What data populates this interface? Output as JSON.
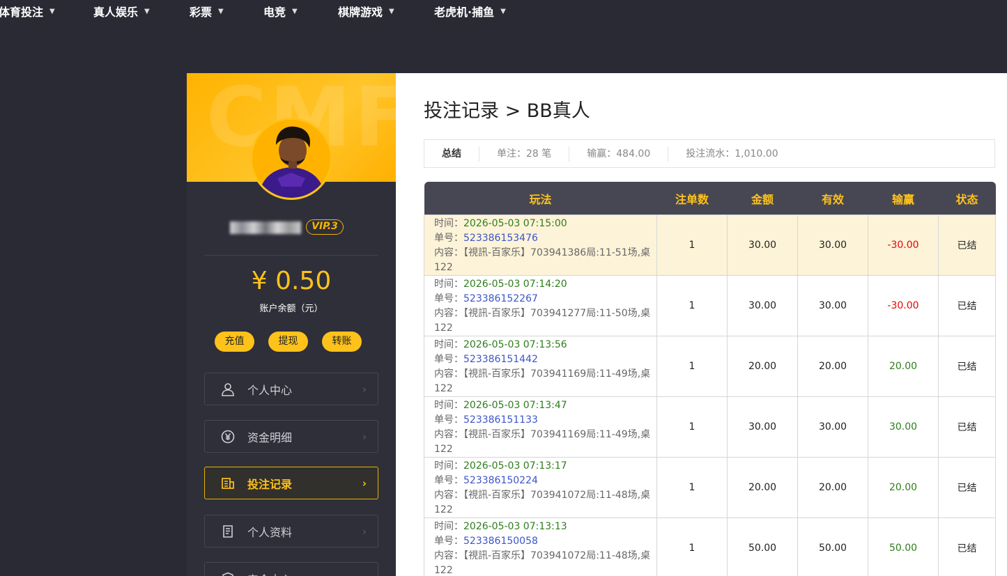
{
  "nav": [
    {
      "label": "体育投注"
    },
    {
      "label": "真人娱乐"
    },
    {
      "label": "彩票"
    },
    {
      "label": "电竞"
    },
    {
      "label": "棋牌游戏"
    },
    {
      "label": "老虎机·捕鱼"
    }
  ],
  "profile": {
    "vip": "VIP.3",
    "balance": "¥ 0.50",
    "balance_label": "账户余额（元）",
    "buttons": [
      "充值",
      "提现",
      "转账"
    ]
  },
  "menu": [
    {
      "label": "个人中心",
      "icon": "user-icon"
    },
    {
      "label": "资金明细",
      "icon": "yuan-cycle-icon"
    },
    {
      "label": "投注记录",
      "icon": "bet-record-icon",
      "active": true
    },
    {
      "label": "个人资料",
      "icon": "profile-doc-icon"
    },
    {
      "label": "安全中心",
      "icon": "shield-icon"
    }
  ],
  "page": {
    "title": "投注记录 > BB真人"
  },
  "summary": {
    "label": "总结",
    "count": "单注：28 笔",
    "profit": "输赢：484.00",
    "turnover": "投注流水：1,010.00"
  },
  "table": {
    "headers": [
      "玩法",
      "注单数",
      "金额",
      "有效",
      "输赢",
      "状态"
    ],
    "labels": {
      "time": "时间：",
      "order": "单号：",
      "content": "内容："
    },
    "rows": [
      {
        "time": "2026-05-03 07:15:00",
        "order": "523386153476",
        "content": "【視訊-百家乐】703941386局:11-51场,桌122",
        "count": "1",
        "amount": "30.00",
        "valid": "30.00",
        "win": "-30.00",
        "status": "已结"
      },
      {
        "time": "2026-05-03 07:14:20",
        "order": "523386152267",
        "content": "【視訊-百家乐】703941277局:11-50场,桌122",
        "count": "1",
        "amount": "30.00",
        "valid": "30.00",
        "win": "-30.00",
        "status": "已结"
      },
      {
        "time": "2026-05-03 07:13:56",
        "order": "523386151442",
        "content": "【視訊-百家乐】703941169局:11-49场,桌122",
        "count": "1",
        "amount": "20.00",
        "valid": "20.00",
        "win": "20.00",
        "status": "已结"
      },
      {
        "time": "2026-05-03 07:13:47",
        "order": "523386151133",
        "content": "【視訊-百家乐】703941169局:11-49场,桌122",
        "count": "1",
        "amount": "30.00",
        "valid": "30.00",
        "win": "30.00",
        "status": "已结"
      },
      {
        "time": "2026-05-03 07:13:17",
        "order": "523386150224",
        "content": "【視訊-百家乐】703941072局:11-48场,桌122",
        "count": "1",
        "amount": "20.00",
        "valid": "20.00",
        "win": "20.00",
        "status": "已结"
      },
      {
        "time": "2026-05-03 07:13:13",
        "order": "523386150058",
        "content": "【視訊-百家乐】703941072局:11-48场,桌122",
        "count": "1",
        "amount": "50.00",
        "valid": "50.00",
        "win": "50.00",
        "status": "已结"
      }
    ]
  }
}
